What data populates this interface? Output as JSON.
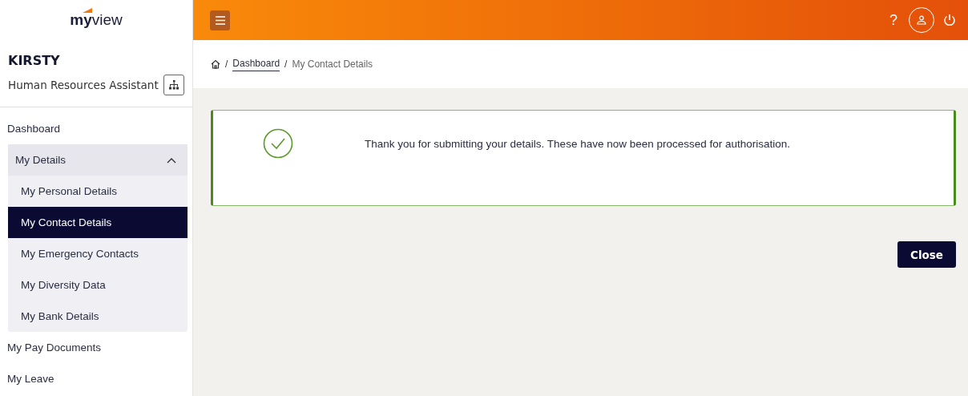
{
  "logo": "**my**view",
  "user": {
    "name": "KIRSTY",
    "role": "Human Resources Assistant"
  },
  "nav": [
    {
      "label": "Dashboard",
      "selected": false
    },
    {
      "label": "My Details",
      "selected": false,
      "expanded": true,
      "children": [
        {
          "label": "My Personal Details",
          "selected": false
        },
        {
          "label": "My Contact Details",
          "selected": true
        },
        {
          "label": "My Emergency Contacts",
          "selected": false
        },
        {
          "label": "My Diversity Data",
          "selected": false
        },
        {
          "label": "My Bank Details",
          "selected": false
        }
      ]
    },
    {
      "label": "My Pay Documents",
      "selected": false
    },
    {
      "label": "My Leave",
      "selected": false
    }
  ],
  "header": {
    "help": "?"
  },
  "breadcrumb": [
    {
      "separator": "/",
      "label": "Dashboard",
      "kind": "link"
    },
    {
      "separator": "/",
      "label": "My Contact Details",
      "kind": "current"
    }
  ],
  "alert": {
    "message": "Thank you for submitting your details. These have now been processed for authorisation."
  },
  "buttons": [
    "Close"
  ]
}
